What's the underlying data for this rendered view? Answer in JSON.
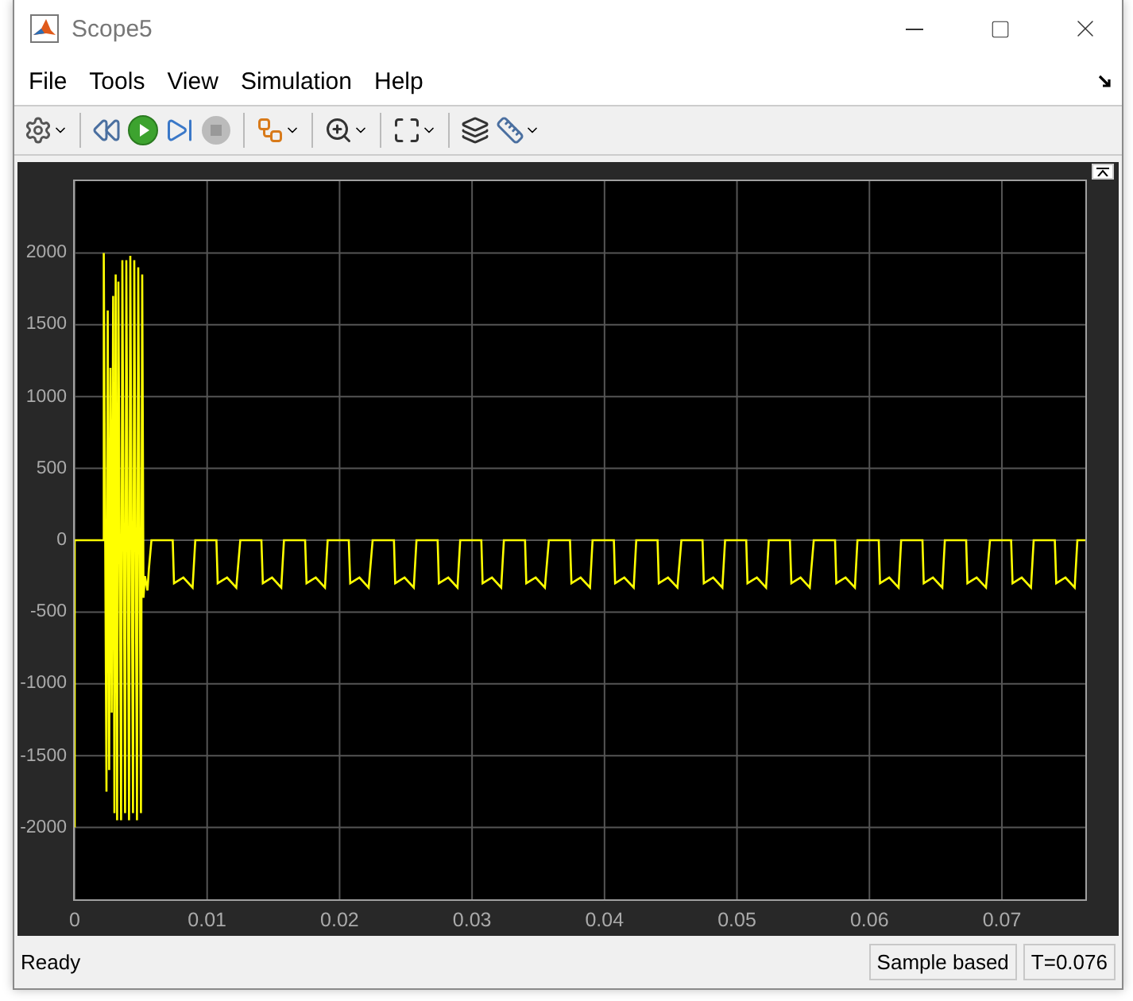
{
  "window": {
    "title": "Scope5"
  },
  "menu": [
    {
      "label": "File"
    },
    {
      "label": "Tools"
    },
    {
      "label": "View"
    },
    {
      "label": "Simulation"
    },
    {
      "label": "Help"
    }
  ],
  "plot": {
    "chart_data": {
      "type": "line",
      "grid": true,
      "xlim": [
        0,
        0.0763
      ],
      "ylim": [
        -2500,
        2500
      ],
      "xticks": [
        {
          "value": 0,
          "label": "0"
        },
        {
          "value": 0.01,
          "label": "0.01"
        },
        {
          "value": 0.02,
          "label": "0.02"
        },
        {
          "value": 0.03,
          "label": "0.03"
        },
        {
          "value": 0.04,
          "label": "0.04"
        },
        {
          "value": 0.05,
          "label": "0.05"
        },
        {
          "value": 0.06,
          "label": "0.06"
        },
        {
          "value": 0.07,
          "label": "0.07"
        }
      ],
      "yticks": [
        {
          "value": 2000,
          "label": "2000"
        },
        {
          "value": 1500,
          "label": "1500"
        },
        {
          "value": 1000,
          "label": "1000"
        },
        {
          "value": 500,
          "label": "500"
        },
        {
          "value": 0,
          "label": "0"
        },
        {
          "value": -500,
          "label": "-500"
        },
        {
          "value": -1000,
          "label": "-1000"
        },
        {
          "value": -1500,
          "label": "-1500"
        },
        {
          "value": -2000,
          "label": "-2000"
        }
      ],
      "x": [
        0,
        0,
        0.0022,
        0.0022,
        0.0024,
        0.0025,
        0.0026,
        0.0027,
        0.0028,
        0.0029,
        0.003,
        0.0031,
        0.0032,
        0.0033,
        0.0035,
        0.0036,
        0.0038,
        0.0039,
        0.0041,
        0.0042,
        0.0044,
        0.0045,
        0.0047,
        0.0048,
        0.005,
        0.0051,
        0.0052,
        0.0053,
        0.0055,
        0.0056,
        0.0058,
        0.0074,
        0.0075,
        0.0082,
        0.0089,
        0.0091,
        0.0107,
        0.0108,
        0.0115,
        0.0122,
        0.0125,
        0.0141,
        0.0142,
        0.0149,
        0.0156,
        0.0158,
        0.0174,
        0.0175,
        0.0182,
        0.0189,
        0.0191,
        0.0207,
        0.0208,
        0.0215,
        0.0222,
        0.0225,
        0.0241,
        0.0242,
        0.0249,
        0.0256,
        0.0258,
        0.0274,
        0.0275,
        0.0282,
        0.0289,
        0.0291,
        0.0307,
        0.0308,
        0.0315,
        0.0322,
        0.0324,
        0.034,
        0.0341,
        0.0348,
        0.0355,
        0.0358,
        0.0374,
        0.0375,
        0.0382,
        0.0389,
        0.0391,
        0.0407,
        0.0408,
        0.0415,
        0.0422,
        0.0424,
        0.044,
        0.0441,
        0.0448,
        0.0455,
        0.0458,
        0.0474,
        0.0475,
        0.0482,
        0.0489,
        0.0491,
        0.0507,
        0.0508,
        0.0515,
        0.0522,
        0.0524,
        0.054,
        0.0541,
        0.0548,
        0.0555,
        0.0558,
        0.0574,
        0.0575,
        0.0582,
        0.0589,
        0.0591,
        0.0607,
        0.0608,
        0.0615,
        0.0622,
        0.0624,
        0.064,
        0.0641,
        0.0648,
        0.0655,
        0.0657,
        0.0673,
        0.0674,
        0.0681,
        0.0688,
        0.0691,
        0.0707,
        0.0708,
        0.0715,
        0.0722,
        0.0724,
        0.074,
        0.0741,
        0.0748,
        0.0755,
        0.0757,
        0.0763
      ],
      "series": [
        {
          "color": "#ffff00",
          "values": [
            -2000,
            0,
            0,
            2000,
            -1750,
            1600,
            -1600,
            1200,
            -1200,
            1700,
            -1900,
            1850,
            -1950,
            1800,
            -1950,
            1950,
            -1900,
            1950,
            -1950,
            1980,
            -1900,
            1950,
            -1950,
            1900,
            -1900,
            1850,
            -400,
            -250,
            -350,
            -200,
            0,
            0,
            -300,
            -260,
            -330,
            0,
            0,
            -300,
            -260,
            -330,
            0,
            0,
            -300,
            -260,
            -330,
            0,
            0,
            -300,
            -260,
            -330,
            0,
            0,
            -300,
            -260,
            -330,
            0,
            0,
            -300,
            -260,
            -330,
            0,
            0,
            -300,
            -260,
            -330,
            0,
            0,
            -300,
            -260,
            -330,
            0,
            0,
            -300,
            -260,
            -330,
            0,
            0,
            -300,
            -260,
            -330,
            0,
            0,
            -300,
            -260,
            -330,
            0,
            0,
            -300,
            -260,
            -330,
            0,
            0,
            -300,
            -260,
            -330,
            0,
            0,
            -300,
            -260,
            -330,
            0,
            0,
            -300,
            -260,
            -330,
            0,
            0,
            -300,
            -260,
            -330,
            0,
            0,
            -300,
            -260,
            -330,
            0,
            0,
            -300,
            -260,
            -330,
            0,
            0,
            -300,
            -260,
            -330,
            0,
            0,
            -300,
            -260,
            -330,
            0,
            0,
            -300,
            -260,
            -330,
            0,
            0
          ]
        }
      ]
    }
  },
  "status_bar": {
    "message": "Ready",
    "mode": "Sample based",
    "time": "T=0.076"
  }
}
